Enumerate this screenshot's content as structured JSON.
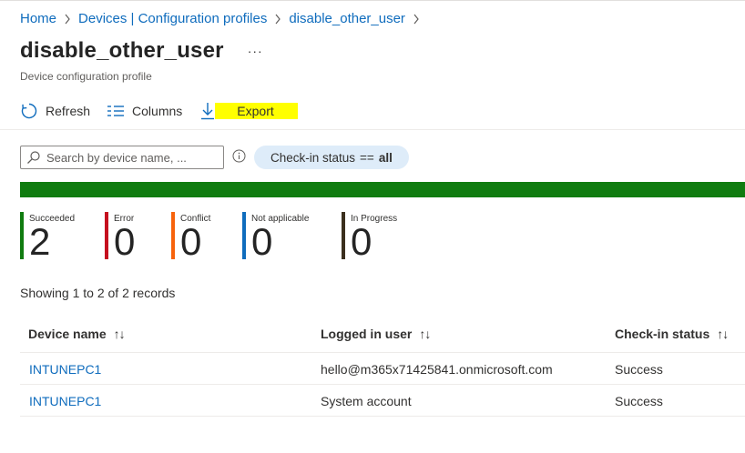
{
  "breadcrumb": {
    "items": [
      "Home",
      "Devices | Configuration profiles",
      "disable_other_user"
    ]
  },
  "header": {
    "title": "disable_other_user",
    "more": "···",
    "subtitle": "Device configuration profile"
  },
  "toolbar": {
    "refresh_label": "Refresh",
    "columns_label": "Columns",
    "export_label": "Export"
  },
  "filter": {
    "search_placeholder": "Search by device name, ...",
    "pill_field": "Check-in status",
    "pill_operator": "==",
    "pill_value": "all"
  },
  "status_bar": {
    "color": "#107c10",
    "succeeded_fraction": 1.0
  },
  "tiles": [
    {
      "label": "Succeeded",
      "count": "2",
      "color": "#107c10"
    },
    {
      "label": "Error",
      "count": "0",
      "color": "#c50f1f"
    },
    {
      "label": "Conflict",
      "count": "0",
      "color": "#f7630c"
    },
    {
      "label": "Not applicable",
      "count": "0",
      "color": "#0f6cbd"
    },
    {
      "label": "In Progress",
      "count": "0",
      "color": "#3b2f1e"
    }
  ],
  "records_text": "Showing 1 to 2 of 2 records",
  "table": {
    "columns": [
      "Device name",
      "Logged in user",
      "Check-in status"
    ],
    "sort_glyph": "↑↓",
    "rows": [
      {
        "device": "INTUNEPC1",
        "user": "hello@m365x71425841.onmicrosoft.com",
        "status": "Success"
      },
      {
        "device": "INTUNEPC1",
        "user": "System account",
        "status": "Success"
      }
    ]
  },
  "colors": {
    "link": "#0f6cbd",
    "highlight": "#ffff00",
    "pill_bg": "#deecf9"
  }
}
